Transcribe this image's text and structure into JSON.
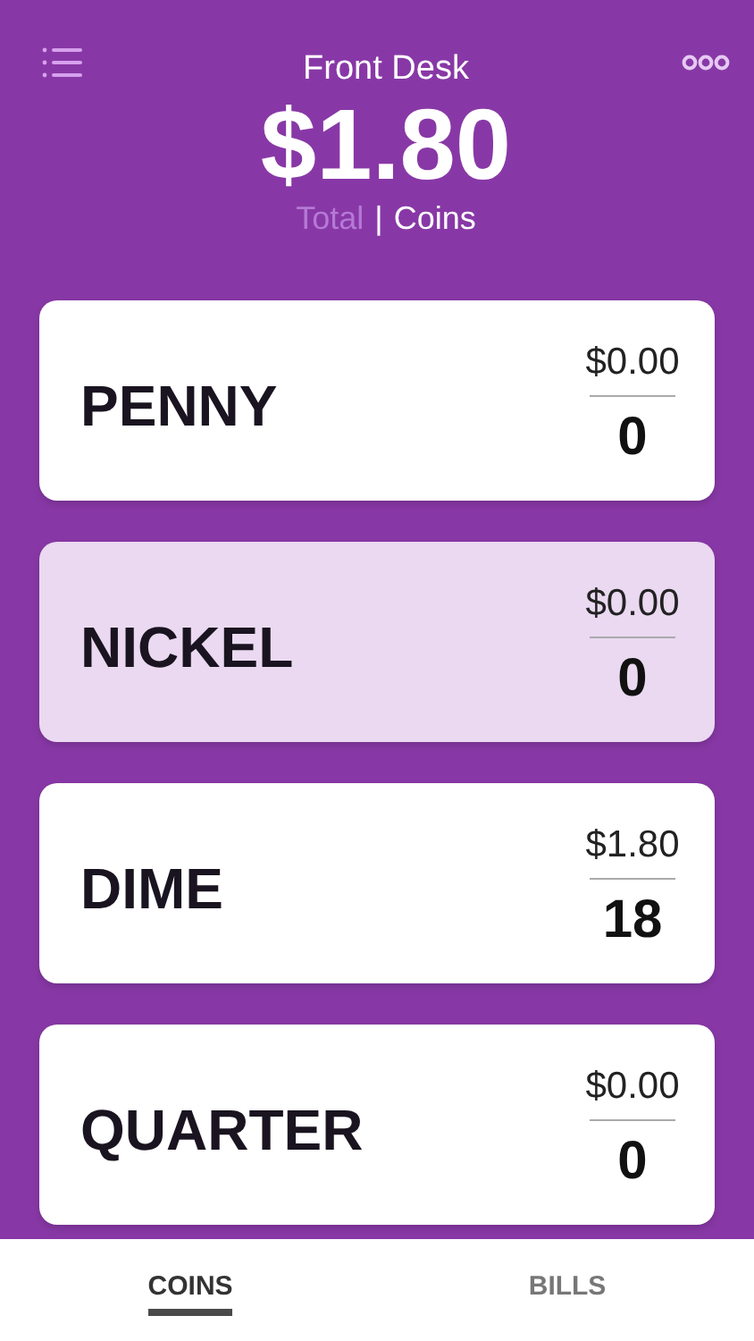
{
  "header": {
    "title": "Front Desk",
    "total": "$1.80",
    "views": [
      {
        "label": "Total",
        "selected": false
      },
      {
        "label": "Coins",
        "selected": true
      }
    ],
    "separator": "|"
  },
  "coins": [
    {
      "name": "PENNY",
      "amount": "$0.00",
      "count": "0",
      "selected": false
    },
    {
      "name": "NICKEL",
      "amount": "$0.00",
      "count": "0",
      "selected": true
    },
    {
      "name": "DIME",
      "amount": "$1.80",
      "count": "18",
      "selected": false
    },
    {
      "name": "QUARTER",
      "amount": "$0.00",
      "count": "0",
      "selected": false
    }
  ],
  "tabs": [
    {
      "label": "COINS",
      "selected": true
    },
    {
      "label": "BILLS",
      "selected": false
    }
  ]
}
